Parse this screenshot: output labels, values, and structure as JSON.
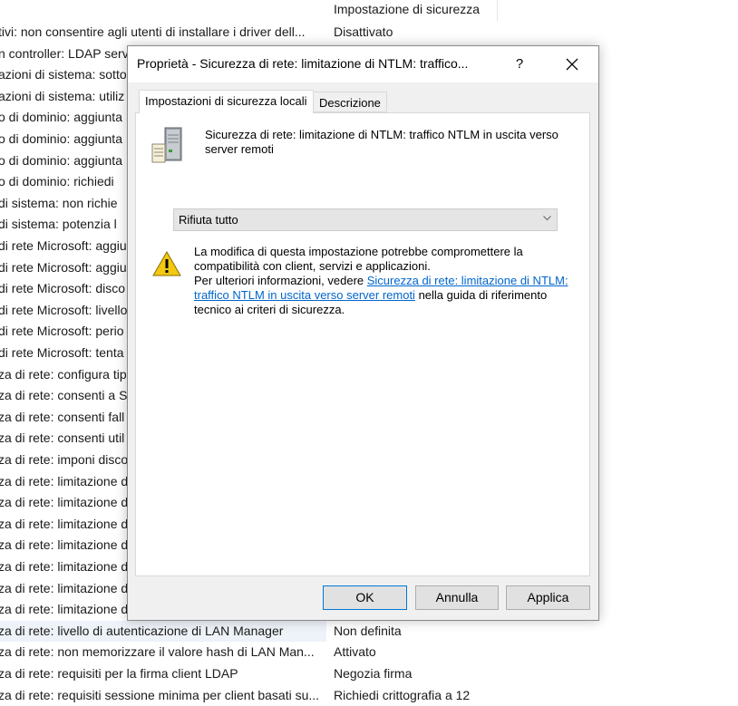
{
  "background": {
    "column_header": "Impostazione di sicurezza",
    "rows": [
      {
        "policy": "tivi: non consentire agli utenti di installare i driver dell...",
        "setting": "Disattivato"
      },
      {
        "policy": "n controller: LDAP server",
        "setting": ""
      },
      {
        "policy": "azioni di sistema: sotto",
        "setting": ""
      },
      {
        "policy": "azioni di sistema: utiliz",
        "setting": ""
      },
      {
        "policy": "o di dominio: aggiunta",
        "setting": ""
      },
      {
        "policy": "o di dominio: aggiunta",
        "setting": ""
      },
      {
        "policy": "o di dominio: aggiunta",
        "setting": ""
      },
      {
        "policy": "o di dominio: richiedi",
        "setting": ""
      },
      {
        "policy": " di sistema: non richie",
        "setting": ""
      },
      {
        "policy": " di sistema: potenzia l",
        "setting": ""
      },
      {
        "policy": "di rete Microsoft: aggiu",
        "setting": ""
      },
      {
        "policy": "di rete Microsoft: aggiu",
        "setting": ""
      },
      {
        "policy": "di rete Microsoft: disco",
        "setting": ""
      },
      {
        "policy": "di rete Microsoft: livello",
        "setting": ""
      },
      {
        "policy": "di rete Microsoft: perio",
        "setting": ""
      },
      {
        "policy": "di rete Microsoft: tenta",
        "setting": ""
      },
      {
        "policy": "za di rete: configura tip",
        "setting": ""
      },
      {
        "policy": "za di rete: consenti a Si",
        "setting": ""
      },
      {
        "policy": "za di rete: consenti fall",
        "setting": ""
      },
      {
        "policy": "za di rete: consenti util",
        "setting": ""
      },
      {
        "policy": "za di rete: imponi disco",
        "setting": ""
      },
      {
        "policy": "za di rete: limitazione d",
        "setting": ""
      },
      {
        "policy": "za di rete: limitazione d",
        "setting": ""
      },
      {
        "policy": "za di rete: limitazione d",
        "setting": ""
      },
      {
        "policy": "za di rete: limitazione d",
        "setting": ""
      },
      {
        "policy": "za di rete: limitazione d",
        "setting": ""
      },
      {
        "policy": "za di rete: limitazione d",
        "setting": ""
      },
      {
        "policy": "za di rete: limitazione d",
        "setting": ""
      },
      {
        "policy": "za di rete: livello di autenticazione di LAN Manager",
        "setting": "Non definita"
      },
      {
        "policy": "za di rete: non memorizzare il valore hash di LAN Man...",
        "setting": "Attivato"
      },
      {
        "policy": "za di rete: requisiti per la firma client LDAP",
        "setting": "Negozia firma"
      },
      {
        "policy": "za di rete: requisiti sessione minima per client basati su...",
        "setting": "Richiedi crittografia a 12"
      }
    ],
    "selected_row_index": 28
  },
  "dialog": {
    "title": "Proprietà - Sicurezza di rete: limitazione di NTLM: traffico...",
    "help_label": "?",
    "tabs": [
      "Impostazioni di sicurezza locali",
      "Descrizione"
    ],
    "policy_name": "Sicurezza di rete: limitazione di NTLM: traffico NTLM in uscita verso server remoti",
    "select": {
      "value": "Rifiuta tutto"
    },
    "warning": {
      "line1": "La modifica di questa impostazione potrebbe compromettere la compatibilità con client, servizi e applicazioni.",
      "pre_link": "Per ulteriori informazioni, vedere ",
      "link": "Sicurezza di rete: limitazione di NTLM: traffico NTLM in uscita verso server remoti",
      "post_link": " nella guida di riferimento tecnico ai criteri di sicurezza."
    },
    "buttons": {
      "ok": "OK",
      "cancel": "Annulla",
      "apply": "Applica"
    }
  },
  "icons": {
    "help": "question-mark-icon",
    "close": "close-icon",
    "server": "server-icon",
    "warning": "warning-icon",
    "dropdown": "chevron-down-icon"
  },
  "colors": {
    "link": "#0066cc",
    "ok_border": "#0078d7",
    "selected_row": "#eef3f9"
  }
}
